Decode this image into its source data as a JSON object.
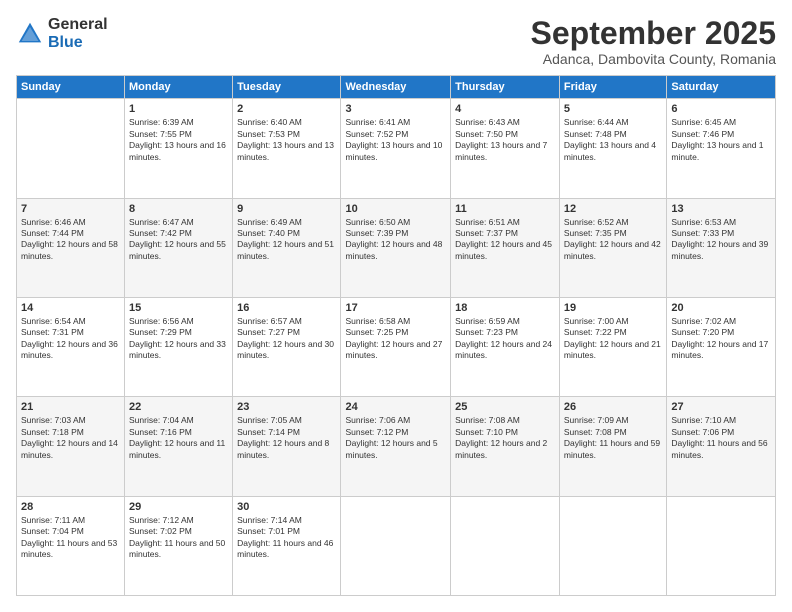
{
  "logo": {
    "general": "General",
    "blue": "Blue"
  },
  "header": {
    "month": "September 2025",
    "location": "Adanca, Dambovita County, Romania"
  },
  "days": [
    "Sunday",
    "Monday",
    "Tuesday",
    "Wednesday",
    "Thursday",
    "Friday",
    "Saturday"
  ],
  "weeks": [
    [
      {
        "date": "",
        "sunrise": "",
        "sunset": "",
        "daylight": ""
      },
      {
        "date": "1",
        "sunrise": "Sunrise: 6:39 AM",
        "sunset": "Sunset: 7:55 PM",
        "daylight": "Daylight: 13 hours and 16 minutes."
      },
      {
        "date": "2",
        "sunrise": "Sunrise: 6:40 AM",
        "sunset": "Sunset: 7:53 PM",
        "daylight": "Daylight: 13 hours and 13 minutes."
      },
      {
        "date": "3",
        "sunrise": "Sunrise: 6:41 AM",
        "sunset": "Sunset: 7:52 PM",
        "daylight": "Daylight: 13 hours and 10 minutes."
      },
      {
        "date": "4",
        "sunrise": "Sunrise: 6:43 AM",
        "sunset": "Sunset: 7:50 PM",
        "daylight": "Daylight: 13 hours and 7 minutes."
      },
      {
        "date": "5",
        "sunrise": "Sunrise: 6:44 AM",
        "sunset": "Sunset: 7:48 PM",
        "daylight": "Daylight: 13 hours and 4 minutes."
      },
      {
        "date": "6",
        "sunrise": "Sunrise: 6:45 AM",
        "sunset": "Sunset: 7:46 PM",
        "daylight": "Daylight: 13 hours and 1 minute."
      }
    ],
    [
      {
        "date": "7",
        "sunrise": "Sunrise: 6:46 AM",
        "sunset": "Sunset: 7:44 PM",
        "daylight": "Daylight: 12 hours and 58 minutes."
      },
      {
        "date": "8",
        "sunrise": "Sunrise: 6:47 AM",
        "sunset": "Sunset: 7:42 PM",
        "daylight": "Daylight: 12 hours and 55 minutes."
      },
      {
        "date": "9",
        "sunrise": "Sunrise: 6:49 AM",
        "sunset": "Sunset: 7:40 PM",
        "daylight": "Daylight: 12 hours and 51 minutes."
      },
      {
        "date": "10",
        "sunrise": "Sunrise: 6:50 AM",
        "sunset": "Sunset: 7:39 PM",
        "daylight": "Daylight: 12 hours and 48 minutes."
      },
      {
        "date": "11",
        "sunrise": "Sunrise: 6:51 AM",
        "sunset": "Sunset: 7:37 PM",
        "daylight": "Daylight: 12 hours and 45 minutes."
      },
      {
        "date": "12",
        "sunrise": "Sunrise: 6:52 AM",
        "sunset": "Sunset: 7:35 PM",
        "daylight": "Daylight: 12 hours and 42 minutes."
      },
      {
        "date": "13",
        "sunrise": "Sunrise: 6:53 AM",
        "sunset": "Sunset: 7:33 PM",
        "daylight": "Daylight: 12 hours and 39 minutes."
      }
    ],
    [
      {
        "date": "14",
        "sunrise": "Sunrise: 6:54 AM",
        "sunset": "Sunset: 7:31 PM",
        "daylight": "Daylight: 12 hours and 36 minutes."
      },
      {
        "date": "15",
        "sunrise": "Sunrise: 6:56 AM",
        "sunset": "Sunset: 7:29 PM",
        "daylight": "Daylight: 12 hours and 33 minutes."
      },
      {
        "date": "16",
        "sunrise": "Sunrise: 6:57 AM",
        "sunset": "Sunset: 7:27 PM",
        "daylight": "Daylight: 12 hours and 30 minutes."
      },
      {
        "date": "17",
        "sunrise": "Sunrise: 6:58 AM",
        "sunset": "Sunset: 7:25 PM",
        "daylight": "Daylight: 12 hours and 27 minutes."
      },
      {
        "date": "18",
        "sunrise": "Sunrise: 6:59 AM",
        "sunset": "Sunset: 7:23 PM",
        "daylight": "Daylight: 12 hours and 24 minutes."
      },
      {
        "date": "19",
        "sunrise": "Sunrise: 7:00 AM",
        "sunset": "Sunset: 7:22 PM",
        "daylight": "Daylight: 12 hours and 21 minutes."
      },
      {
        "date": "20",
        "sunrise": "Sunrise: 7:02 AM",
        "sunset": "Sunset: 7:20 PM",
        "daylight": "Daylight: 12 hours and 17 minutes."
      }
    ],
    [
      {
        "date": "21",
        "sunrise": "Sunrise: 7:03 AM",
        "sunset": "Sunset: 7:18 PM",
        "daylight": "Daylight: 12 hours and 14 minutes."
      },
      {
        "date": "22",
        "sunrise": "Sunrise: 7:04 AM",
        "sunset": "Sunset: 7:16 PM",
        "daylight": "Daylight: 12 hours and 11 minutes."
      },
      {
        "date": "23",
        "sunrise": "Sunrise: 7:05 AM",
        "sunset": "Sunset: 7:14 PM",
        "daylight": "Daylight: 12 hours and 8 minutes."
      },
      {
        "date": "24",
        "sunrise": "Sunrise: 7:06 AM",
        "sunset": "Sunset: 7:12 PM",
        "daylight": "Daylight: 12 hours and 5 minutes."
      },
      {
        "date": "25",
        "sunrise": "Sunrise: 7:08 AM",
        "sunset": "Sunset: 7:10 PM",
        "daylight": "Daylight: 12 hours and 2 minutes."
      },
      {
        "date": "26",
        "sunrise": "Sunrise: 7:09 AM",
        "sunset": "Sunset: 7:08 PM",
        "daylight": "Daylight: 11 hours and 59 minutes."
      },
      {
        "date": "27",
        "sunrise": "Sunrise: 7:10 AM",
        "sunset": "Sunset: 7:06 PM",
        "daylight": "Daylight: 11 hours and 56 minutes."
      }
    ],
    [
      {
        "date": "28",
        "sunrise": "Sunrise: 7:11 AM",
        "sunset": "Sunset: 7:04 PM",
        "daylight": "Daylight: 11 hours and 53 minutes."
      },
      {
        "date": "29",
        "sunrise": "Sunrise: 7:12 AM",
        "sunset": "Sunset: 7:02 PM",
        "daylight": "Daylight: 11 hours and 50 minutes."
      },
      {
        "date": "30",
        "sunrise": "Sunrise: 7:14 AM",
        "sunset": "Sunset: 7:01 PM",
        "daylight": "Daylight: 11 hours and 46 minutes."
      },
      {
        "date": "",
        "sunrise": "",
        "sunset": "",
        "daylight": ""
      },
      {
        "date": "",
        "sunrise": "",
        "sunset": "",
        "daylight": ""
      },
      {
        "date": "",
        "sunrise": "",
        "sunset": "",
        "daylight": ""
      },
      {
        "date": "",
        "sunrise": "",
        "sunset": "",
        "daylight": ""
      }
    ]
  ]
}
